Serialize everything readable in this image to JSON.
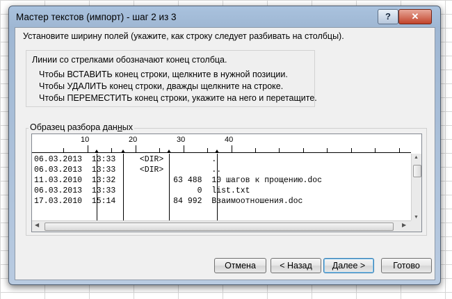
{
  "window": {
    "title": "Мастер текстов (импорт) - шаг 2 из 3",
    "help_glyph": "?",
    "close_glyph": "✕"
  },
  "instruction": "Установите ширину полей (укажите, как строку следует разбивать на столбцы).",
  "info": {
    "heading": "Линии со стрелками обозначают конец столбца.",
    "lines": [
      "Чтобы ВСТАВИТЬ конец строки, щелкните в нужной позиции.",
      "Чтобы УДАЛИТЬ конец строки, дважды щелкните на строке.",
      "Чтобы ПЕРЕМЕСТИТЬ конец строки, укажите на него и перетащите."
    ]
  },
  "preview": {
    "label_before": "Образец разбора дан",
    "label_underlined": "н",
    "label_after": "ых",
    "ruler_labels": [
      "10",
      "20",
      "30",
      "40"
    ],
    "rows": [
      "06.03.2013  13:33     <DIR>          .",
      "06.03.2013  13:33     <DIR>          ..",
      "11.03.2010  13:32            63 488  10 шагов к прощению.doc",
      "06.03.2013  13:33                 0  list.txt",
      "17.03.2010  15:14            84 992  Взаимоотношения.doc"
    ]
  },
  "buttons": {
    "cancel": "Отмена",
    "back": "< Назад",
    "next": "Далее >",
    "finish": "Готово"
  },
  "icons": {
    "help": "help-icon",
    "close": "close-icon",
    "scroll_up": "scroll-up-arrow-icon",
    "scroll_down": "scroll-down-arrow-icon",
    "scroll_left": "scroll-left-arrow-icon",
    "scroll_right": "scroll-right-arrow-icon"
  }
}
